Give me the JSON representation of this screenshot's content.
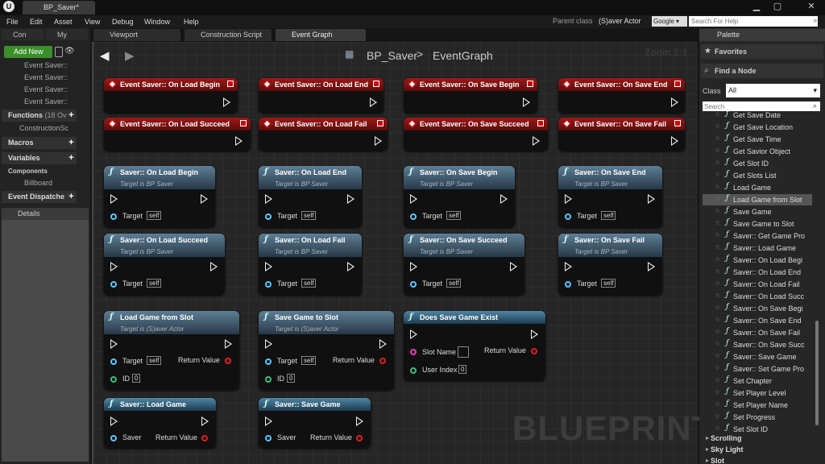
{
  "window": {
    "tab": "BP_Saver*",
    "logo": "U"
  },
  "menu": [
    "File",
    "Edit",
    "Asset",
    "View",
    "Debug",
    "Window",
    "Help"
  ],
  "parent_class": {
    "label": "Parent class",
    "value": "(S)aver Actor"
  },
  "search": {
    "engine": "Google",
    "placeholder": "Search For Help"
  },
  "left": {
    "tabs": [
      "Con",
      "My"
    ],
    "add_new": "Add New",
    "events": [
      "Event Saver::",
      "Event Saver::",
      "Event Saver::",
      "Event Saver::"
    ],
    "sections": {
      "functions": "Functions",
      "functions_count": "(18 Ov",
      "macros": "Macros",
      "variables": "Variables",
      "components": "Components",
      "dispatchers": "Event Dispatche"
    },
    "function_item": "ConstructionSc",
    "component_item": "Billboard",
    "details": "Details"
  },
  "editor_tabs": [
    "Viewport",
    "Construction Script",
    "Event Graph"
  ],
  "graph": {
    "crumb": "BP_Saver",
    "sep": ">",
    "name": "EventGraph",
    "zoom": "Zoom 1:1",
    "watermark": "BLUEPRINT"
  },
  "event_nodes": [
    "Event Saver:: On Load Begin",
    "Event Saver:: On Load End",
    "Event Saver:: On Save Begin",
    "Event Saver:: On Save End",
    "Event Saver:: On Load Succeed",
    "Event Saver:: On Load Fail",
    "Event Saver:: On Save Succeed",
    "Event Saver:: On Save Fail"
  ],
  "call_nodes": [
    "Saver:: On Load Begin",
    "Saver:: On Load End",
    "Saver:: On Save Begin",
    "Saver:: On Save End",
    "Saver:: On Load Succeed",
    "Saver:: On Load Fail",
    "Saver:: On Save Succeed",
    "Saver:: On Save Fail"
  ],
  "target_text": "Target is BP Saver",
  "pin_target": "Target",
  "pin_self": "self",
  "fn_nodes": {
    "load": {
      "title": "Load Game from Slot",
      "sub": "Target is (S)aver Actor",
      "id": "ID",
      "id_val": "0",
      "ret": "Return Value"
    },
    "save": {
      "title": "Save Game to Slot",
      "sub": "Target is (S)aver Actor",
      "id": "ID",
      "id_val": "0",
      "ret": "Return Value"
    },
    "exist": {
      "title": "Does Save Game Exist",
      "slot": "Slot Name",
      "user": "User Index",
      "user_val": "0",
      "ret": "Return Value"
    },
    "saverload": {
      "title": "Saver:: Load Game",
      "pin": "Saver",
      "ret": "Return Value"
    },
    "saversave": {
      "title": "Saver:: Save Game",
      "pin": "Saver",
      "ret": "Return Value"
    }
  },
  "palette": {
    "tab": "Palette",
    "favorites": "Favorites",
    "find": "Find a Node",
    "class_label": "Class",
    "class_value": "All",
    "search_placeholder": "Search",
    "items": [
      "Get Save Date",
      "Get Save Location",
      "Get Save Time",
      "Get Savior Object",
      "Get Slot ID",
      "Get Slots List",
      "Load Game",
      "Load Game from Slot",
      "Save Game",
      "Save Game to Slot",
      "Saver:: Get Game Pro",
      "Saver:: Load Game",
      "Saver:: On Load Begi",
      "Saver:: On Load End",
      "Saver:: On Load Fail",
      "Saver:: On Load Succ",
      "Saver:: On Save Begi",
      "Saver:: On Save End",
      "Saver:: On Save Fail",
      "Saver:: On Save Succ",
      "Saver:: Save Game",
      "Saver:: Set Game Pro",
      "Set Chapter",
      "Set Player Level",
      "Set Player Name",
      "Set Progress",
      "Set Slot ID"
    ],
    "categories": [
      "Scrolling",
      "Sky Light",
      "Slot"
    ]
  }
}
